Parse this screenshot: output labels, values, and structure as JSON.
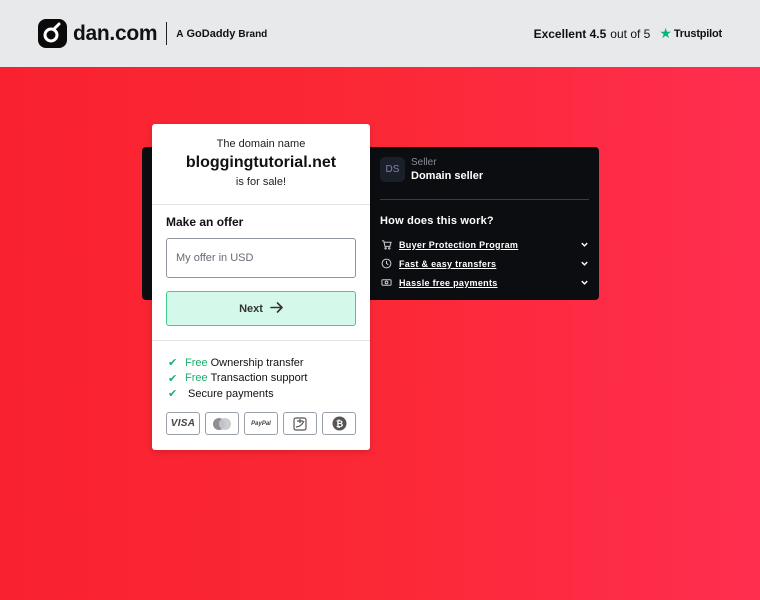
{
  "header": {
    "logo_text": "dan.com",
    "godaddy_prefix": "A",
    "godaddy_name": "GoDaddy",
    "godaddy_suffix": "Brand",
    "trust_excellent": "Excellent 4.5",
    "trust_outof": "out of 5",
    "trust_brand": "Trustpilot"
  },
  "card": {
    "the_domain_label": "The domain name",
    "domain": "bloggingtutorial.net",
    "for_sale": "is for sale!",
    "offer_title": "Make an offer",
    "offer_placeholder": "My offer in USD",
    "next_label": "Next",
    "benefits": [
      {
        "free": "Free",
        "text": "Ownership transfer"
      },
      {
        "free": "Free",
        "text": "Transaction support"
      },
      {
        "free": "",
        "text": "Secure payments"
      }
    ],
    "payments": [
      "VISA",
      "mastercard",
      "PayPal",
      "alipay",
      "bitcoin"
    ]
  },
  "seller": {
    "avatar": "DS",
    "label": "Seller",
    "name": "Domain seller",
    "how_title": "How does this work?",
    "items": [
      {
        "icon": "cart-icon",
        "label": "Buyer Protection Program"
      },
      {
        "icon": "clock-icon",
        "label": "Fast & easy transfers"
      },
      {
        "icon": "cash-icon",
        "label": "Hassle free payments"
      }
    ]
  },
  "colors": {
    "accent_green": "#1fae6d",
    "button_bg": "#d4f8e9",
    "background_red": "#f9212f",
    "trustpilot_green": "#00b67a"
  }
}
